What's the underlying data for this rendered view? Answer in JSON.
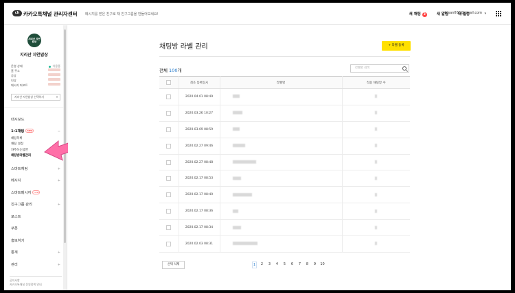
{
  "header": {
    "logo_text": "ch",
    "brand_title": "카카오톡채널 관리자센터",
    "notice": "메시지를 받은 친구로 채 친구그룹을 만들어보세요!",
    "nav": [
      {
        "label": "새 채팅",
        "badge": "3"
      },
      {
        "label": "새 알림",
        "badge": ""
      },
      {
        "label": "내 일정",
        "badge": ""
      }
    ],
    "user_email": "jirisan000@gmail.com",
    "caret": "▾"
  },
  "sidebar": {
    "logo_text": "지리산 자연밥상",
    "channel_name": "지리산 자연밥상",
    "info": [
      {
        "label": "운영 상태",
        "value": "이용중"
      },
      {
        "label": "홈 주소",
        "value": ""
      },
      {
        "label": "공상",
        "value": ""
      },
      {
        "label": "인상",
        "value": ""
      },
      {
        "label": "메시지 퍼포트",
        "value": ""
      }
    ],
    "channel_select": "지리산 자연밥상 선택하기",
    "select_chevron": "▾",
    "menu_dashboard": "대시보드",
    "chat_group": "1:1채팅",
    "chat_new_badge": "new",
    "chat_sub": [
      "채팅목록",
      "채팅 설정",
      "자주쓰는답변",
      "채팅방라벨관리"
    ],
    "menu_items": [
      {
        "label": "스마트채팅",
        "badge": ""
      },
      {
        "label": "메시지",
        "badge": ""
      },
      {
        "label": "스마트메시지",
        "badge": "new"
      },
      {
        "label": "친구그룹 관리",
        "badge": ""
      },
      {
        "label": "포스트",
        "badge": ""
      },
      {
        "label": "쿠폰",
        "badge": ""
      },
      {
        "label": "홍보하기",
        "badge": ""
      },
      {
        "label": "통계",
        "badge": ""
      },
      {
        "label": "관리",
        "badge": ""
      }
    ],
    "bottom_lines": [
      "공지사항",
      "카카오톡채널 운영정책 안내"
    ]
  },
  "main": {
    "title": "채팅방 라벨 관리",
    "register_button": "+ 라벨 등록",
    "total_prefix": "전체",
    "total_count": "100",
    "total_suffix": "개",
    "search_placeholder": "라벨명 검색",
    "columns": [
      "최초 등록일시",
      "라벨명",
      "적용 채팅방 수"
    ],
    "rows": [
      {
        "date": "2020.04.01 08:49"
      },
      {
        "date": "2020.03.26 10:27"
      },
      {
        "date": "2020.03.09 08:59"
      },
      {
        "date": "2020.02.27 09:46"
      },
      {
        "date": "2020.02.27 08:48"
      },
      {
        "date": "2020.02.17 08:53"
      },
      {
        "date": "2020.02.17 08:40"
      },
      {
        "date": "2020.02.17 08:36"
      },
      {
        "date": "2020.02.17 08:34"
      },
      {
        "date": "2020.02.03 08:31"
      }
    ],
    "delete_button": "선택 삭제",
    "pages": [
      "1",
      "2",
      "3",
      "4",
      "5",
      "6",
      "7",
      "8",
      "9",
      "10"
    ],
    "current_page": "1"
  },
  "colors": {
    "accent_yellow": "#ffe001",
    "link_blue": "#1a73c8",
    "annotation_pink": "#ff6fa8"
  }
}
